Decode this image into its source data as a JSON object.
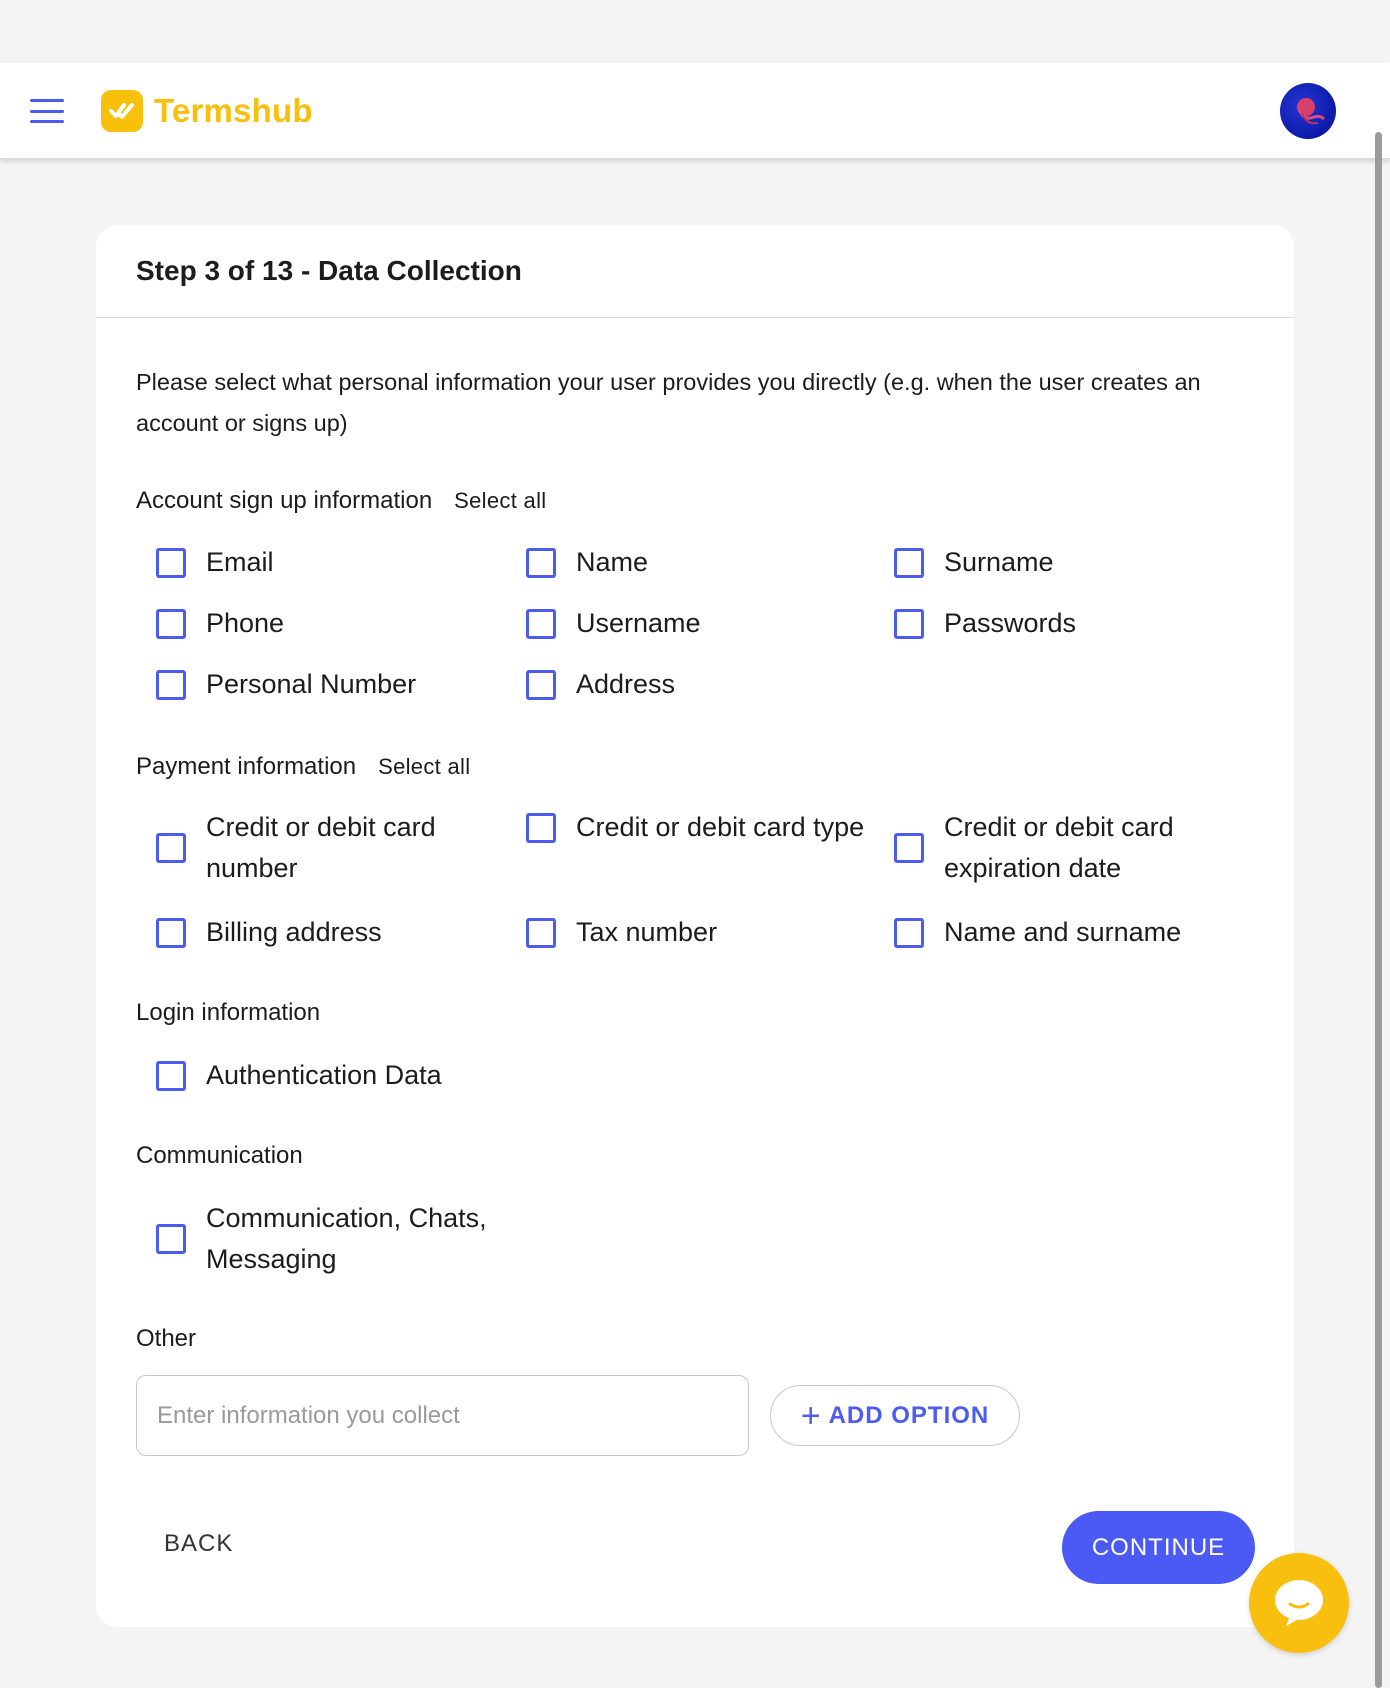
{
  "header": {
    "brand_name": "Termshub",
    "menu_icon": "hamburger-menu-icon",
    "logo_icon": "termshub-logo-icon",
    "avatar_icon": "user-avatar",
    "accent_color": "#4c5bf0",
    "brand_color": "#f8bf0d"
  },
  "card": {
    "title": "Step 3 of 13 - Data Collection",
    "intro": "Please select what personal information your user provides you directly (e.g. when the user creates an account or signs up)"
  },
  "sections": {
    "account": {
      "title": "Account sign up information",
      "select_all": "Select all",
      "options": [
        "Email",
        "Name",
        "Surname",
        "Phone",
        "Username",
        "Passwords",
        "Personal Number",
        "Address"
      ]
    },
    "payment": {
      "title": "Payment information",
      "select_all": "Select all",
      "options": [
        "Credit or debit card number",
        "Credit or debit card type",
        "Credit or debit card expiration date",
        "Billing address",
        "Tax number",
        "Name and surname"
      ]
    },
    "login": {
      "title": "Login information",
      "options": [
        "Authentication Data"
      ]
    },
    "communication": {
      "title": "Communication",
      "options": [
        "Communication, Chats, Messaging"
      ]
    },
    "other": {
      "title": "Other",
      "placeholder": "Enter information you collect",
      "add_label": "ADD OPTION"
    }
  },
  "footer": {
    "back_label": "BACK",
    "continue_label": "CONTINUE",
    "continue_color": "#4b59f5"
  },
  "chat": {
    "icon": "chat-bubble-icon",
    "color": "#f9bf0e"
  }
}
